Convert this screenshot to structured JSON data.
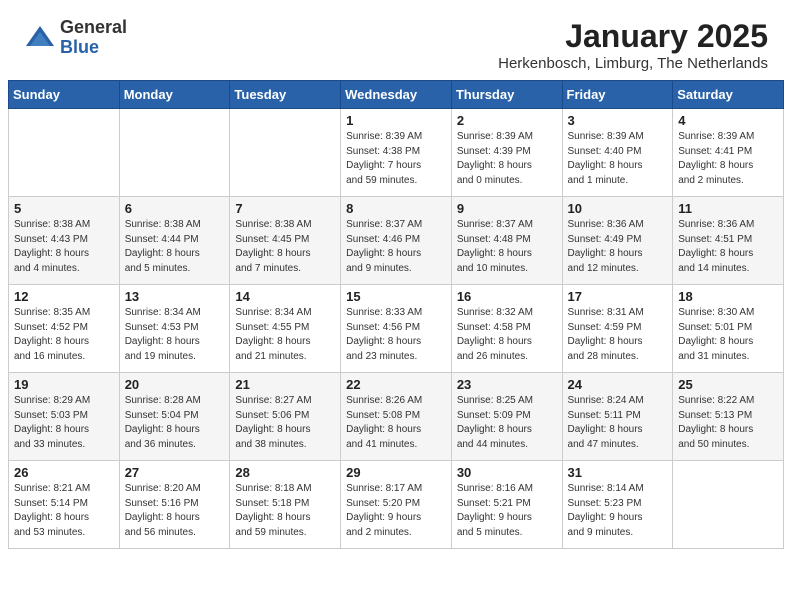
{
  "header": {
    "logo_general": "General",
    "logo_blue": "Blue",
    "month": "January 2025",
    "location": "Herkenbosch, Limburg, The Netherlands"
  },
  "days_of_week": [
    "Sunday",
    "Monday",
    "Tuesday",
    "Wednesday",
    "Thursday",
    "Friday",
    "Saturday"
  ],
  "weeks": [
    [
      {
        "day": "",
        "content": ""
      },
      {
        "day": "",
        "content": ""
      },
      {
        "day": "",
        "content": ""
      },
      {
        "day": "1",
        "content": "Sunrise: 8:39 AM\nSunset: 4:38 PM\nDaylight: 7 hours\nand 59 minutes."
      },
      {
        "day": "2",
        "content": "Sunrise: 8:39 AM\nSunset: 4:39 PM\nDaylight: 8 hours\nand 0 minutes."
      },
      {
        "day": "3",
        "content": "Sunrise: 8:39 AM\nSunset: 4:40 PM\nDaylight: 8 hours\nand 1 minute."
      },
      {
        "day": "4",
        "content": "Sunrise: 8:39 AM\nSunset: 4:41 PM\nDaylight: 8 hours\nand 2 minutes."
      }
    ],
    [
      {
        "day": "5",
        "content": "Sunrise: 8:38 AM\nSunset: 4:43 PM\nDaylight: 8 hours\nand 4 minutes."
      },
      {
        "day": "6",
        "content": "Sunrise: 8:38 AM\nSunset: 4:44 PM\nDaylight: 8 hours\nand 5 minutes."
      },
      {
        "day": "7",
        "content": "Sunrise: 8:38 AM\nSunset: 4:45 PM\nDaylight: 8 hours\nand 7 minutes."
      },
      {
        "day": "8",
        "content": "Sunrise: 8:37 AM\nSunset: 4:46 PM\nDaylight: 8 hours\nand 9 minutes."
      },
      {
        "day": "9",
        "content": "Sunrise: 8:37 AM\nSunset: 4:48 PM\nDaylight: 8 hours\nand 10 minutes."
      },
      {
        "day": "10",
        "content": "Sunrise: 8:36 AM\nSunset: 4:49 PM\nDaylight: 8 hours\nand 12 minutes."
      },
      {
        "day": "11",
        "content": "Sunrise: 8:36 AM\nSunset: 4:51 PM\nDaylight: 8 hours\nand 14 minutes."
      }
    ],
    [
      {
        "day": "12",
        "content": "Sunrise: 8:35 AM\nSunset: 4:52 PM\nDaylight: 8 hours\nand 16 minutes."
      },
      {
        "day": "13",
        "content": "Sunrise: 8:34 AM\nSunset: 4:53 PM\nDaylight: 8 hours\nand 19 minutes."
      },
      {
        "day": "14",
        "content": "Sunrise: 8:34 AM\nSunset: 4:55 PM\nDaylight: 8 hours\nand 21 minutes."
      },
      {
        "day": "15",
        "content": "Sunrise: 8:33 AM\nSunset: 4:56 PM\nDaylight: 8 hours\nand 23 minutes."
      },
      {
        "day": "16",
        "content": "Sunrise: 8:32 AM\nSunset: 4:58 PM\nDaylight: 8 hours\nand 26 minutes."
      },
      {
        "day": "17",
        "content": "Sunrise: 8:31 AM\nSunset: 4:59 PM\nDaylight: 8 hours\nand 28 minutes."
      },
      {
        "day": "18",
        "content": "Sunrise: 8:30 AM\nSunset: 5:01 PM\nDaylight: 8 hours\nand 31 minutes."
      }
    ],
    [
      {
        "day": "19",
        "content": "Sunrise: 8:29 AM\nSunset: 5:03 PM\nDaylight: 8 hours\nand 33 minutes."
      },
      {
        "day": "20",
        "content": "Sunrise: 8:28 AM\nSunset: 5:04 PM\nDaylight: 8 hours\nand 36 minutes."
      },
      {
        "day": "21",
        "content": "Sunrise: 8:27 AM\nSunset: 5:06 PM\nDaylight: 8 hours\nand 38 minutes."
      },
      {
        "day": "22",
        "content": "Sunrise: 8:26 AM\nSunset: 5:08 PM\nDaylight: 8 hours\nand 41 minutes."
      },
      {
        "day": "23",
        "content": "Sunrise: 8:25 AM\nSunset: 5:09 PM\nDaylight: 8 hours\nand 44 minutes."
      },
      {
        "day": "24",
        "content": "Sunrise: 8:24 AM\nSunset: 5:11 PM\nDaylight: 8 hours\nand 47 minutes."
      },
      {
        "day": "25",
        "content": "Sunrise: 8:22 AM\nSunset: 5:13 PM\nDaylight: 8 hours\nand 50 minutes."
      }
    ],
    [
      {
        "day": "26",
        "content": "Sunrise: 8:21 AM\nSunset: 5:14 PM\nDaylight: 8 hours\nand 53 minutes."
      },
      {
        "day": "27",
        "content": "Sunrise: 8:20 AM\nSunset: 5:16 PM\nDaylight: 8 hours\nand 56 minutes."
      },
      {
        "day": "28",
        "content": "Sunrise: 8:18 AM\nSunset: 5:18 PM\nDaylight: 8 hours\nand 59 minutes."
      },
      {
        "day": "29",
        "content": "Sunrise: 8:17 AM\nSunset: 5:20 PM\nDaylight: 9 hours\nand 2 minutes."
      },
      {
        "day": "30",
        "content": "Sunrise: 8:16 AM\nSunset: 5:21 PM\nDaylight: 9 hours\nand 5 minutes."
      },
      {
        "day": "31",
        "content": "Sunrise: 8:14 AM\nSunset: 5:23 PM\nDaylight: 9 hours\nand 9 minutes."
      },
      {
        "day": "",
        "content": ""
      }
    ]
  ]
}
